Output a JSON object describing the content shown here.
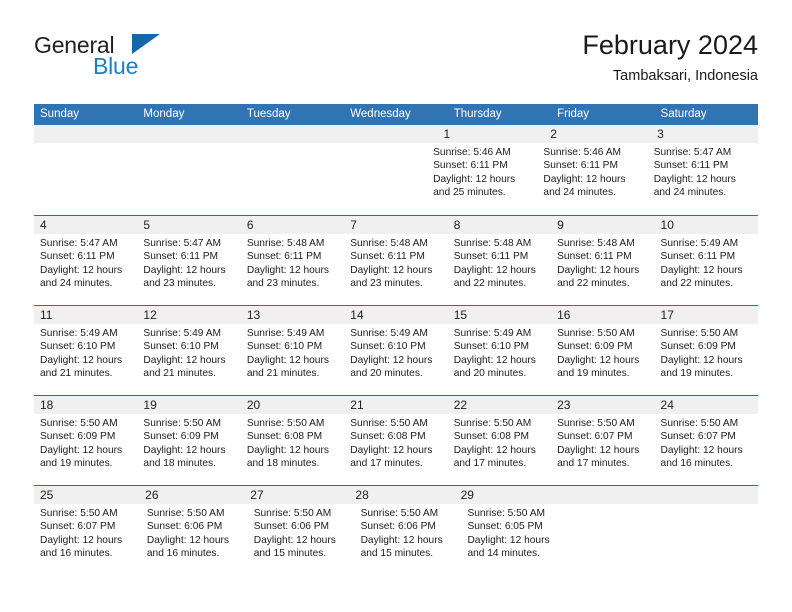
{
  "brand": {
    "name_part1": "General",
    "name_part2": "Blue",
    "triangle_color": "#1566ad",
    "blue_text_color": "#1c7fc4"
  },
  "header": {
    "month_title": "February 2024",
    "location": "Tambaksari, Indonesia"
  },
  "colors": {
    "header_blue": "#3174b4",
    "week_divider": "#2e6da4",
    "daynum_band": "#f0f0f0"
  },
  "calendar": {
    "weekdays": [
      "Sunday",
      "Monday",
      "Tuesday",
      "Wednesday",
      "Thursday",
      "Friday",
      "Saturday"
    ],
    "weeks": [
      [
        {
          "day": "",
          "lines": []
        },
        {
          "day": "",
          "lines": []
        },
        {
          "day": "",
          "lines": []
        },
        {
          "day": "",
          "lines": []
        },
        {
          "day": "1",
          "lines": [
            "Sunrise: 5:46 AM",
            "Sunset: 6:11 PM",
            "Daylight: 12 hours and 25 minutes."
          ]
        },
        {
          "day": "2",
          "lines": [
            "Sunrise: 5:46 AM",
            "Sunset: 6:11 PM",
            "Daylight: 12 hours and 24 minutes."
          ]
        },
        {
          "day": "3",
          "lines": [
            "Sunrise: 5:47 AM",
            "Sunset: 6:11 PM",
            "Daylight: 12 hours and 24 minutes."
          ]
        }
      ],
      [
        {
          "day": "4",
          "lines": [
            "Sunrise: 5:47 AM",
            "Sunset: 6:11 PM",
            "Daylight: 12 hours and 24 minutes."
          ]
        },
        {
          "day": "5",
          "lines": [
            "Sunrise: 5:47 AM",
            "Sunset: 6:11 PM",
            "Daylight: 12 hours and 23 minutes."
          ]
        },
        {
          "day": "6",
          "lines": [
            "Sunrise: 5:48 AM",
            "Sunset: 6:11 PM",
            "Daylight: 12 hours and 23 minutes."
          ]
        },
        {
          "day": "7",
          "lines": [
            "Sunrise: 5:48 AM",
            "Sunset: 6:11 PM",
            "Daylight: 12 hours and 23 minutes."
          ]
        },
        {
          "day": "8",
          "lines": [
            "Sunrise: 5:48 AM",
            "Sunset: 6:11 PM",
            "Daylight: 12 hours and 22 minutes."
          ]
        },
        {
          "day": "9",
          "lines": [
            "Sunrise: 5:48 AM",
            "Sunset: 6:11 PM",
            "Daylight: 12 hours and 22 minutes."
          ]
        },
        {
          "day": "10",
          "lines": [
            "Sunrise: 5:49 AM",
            "Sunset: 6:11 PM",
            "Daylight: 12 hours and 22 minutes."
          ]
        }
      ],
      [
        {
          "day": "11",
          "lines": [
            "Sunrise: 5:49 AM",
            "Sunset: 6:10 PM",
            "Daylight: 12 hours and 21 minutes."
          ]
        },
        {
          "day": "12",
          "lines": [
            "Sunrise: 5:49 AM",
            "Sunset: 6:10 PM",
            "Daylight: 12 hours and 21 minutes."
          ]
        },
        {
          "day": "13",
          "lines": [
            "Sunrise: 5:49 AM",
            "Sunset: 6:10 PM",
            "Daylight: 12 hours and 21 minutes."
          ]
        },
        {
          "day": "14",
          "lines": [
            "Sunrise: 5:49 AM",
            "Sunset: 6:10 PM",
            "Daylight: 12 hours and 20 minutes."
          ]
        },
        {
          "day": "15",
          "lines": [
            "Sunrise: 5:49 AM",
            "Sunset: 6:10 PM",
            "Daylight: 12 hours and 20 minutes."
          ]
        },
        {
          "day": "16",
          "lines": [
            "Sunrise: 5:50 AM",
            "Sunset: 6:09 PM",
            "Daylight: 12 hours and 19 minutes."
          ]
        },
        {
          "day": "17",
          "lines": [
            "Sunrise: 5:50 AM",
            "Sunset: 6:09 PM",
            "Daylight: 12 hours and 19 minutes."
          ]
        }
      ],
      [
        {
          "day": "18",
          "lines": [
            "Sunrise: 5:50 AM",
            "Sunset: 6:09 PM",
            "Daylight: 12 hours and 19 minutes."
          ]
        },
        {
          "day": "19",
          "lines": [
            "Sunrise: 5:50 AM",
            "Sunset: 6:09 PM",
            "Daylight: 12 hours and 18 minutes."
          ]
        },
        {
          "day": "20",
          "lines": [
            "Sunrise: 5:50 AM",
            "Sunset: 6:08 PM",
            "Daylight: 12 hours and 18 minutes."
          ]
        },
        {
          "day": "21",
          "lines": [
            "Sunrise: 5:50 AM",
            "Sunset: 6:08 PM",
            "Daylight: 12 hours and 17 minutes."
          ]
        },
        {
          "day": "22",
          "lines": [
            "Sunrise: 5:50 AM",
            "Sunset: 6:08 PM",
            "Daylight: 12 hours and 17 minutes."
          ]
        },
        {
          "day": "23",
          "lines": [
            "Sunrise: 5:50 AM",
            "Sunset: 6:07 PM",
            "Daylight: 12 hours and 17 minutes."
          ]
        },
        {
          "day": "24",
          "lines": [
            "Sunrise: 5:50 AM",
            "Sunset: 6:07 PM",
            "Daylight: 12 hours and 16 minutes."
          ]
        }
      ],
      [
        {
          "day": "25",
          "lines": [
            "Sunrise: 5:50 AM",
            "Sunset: 6:07 PM",
            "Daylight: 12 hours and 16 minutes."
          ]
        },
        {
          "day": "26",
          "lines": [
            "Sunrise: 5:50 AM",
            "Sunset: 6:06 PM",
            "Daylight: 12 hours and 16 minutes."
          ]
        },
        {
          "day": "27",
          "lines": [
            "Sunrise: 5:50 AM",
            "Sunset: 6:06 PM",
            "Daylight: 12 hours and 15 minutes."
          ]
        },
        {
          "day": "28",
          "lines": [
            "Sunrise: 5:50 AM",
            "Sunset: 6:06 PM",
            "Daylight: 12 hours and 15 minutes."
          ]
        },
        {
          "day": "29",
          "lines": [
            "Sunrise: 5:50 AM",
            "Sunset: 6:05 PM",
            "Daylight: 12 hours and 14 minutes."
          ]
        },
        {
          "day": "",
          "lines": []
        },
        {
          "day": "",
          "lines": []
        }
      ]
    ]
  }
}
